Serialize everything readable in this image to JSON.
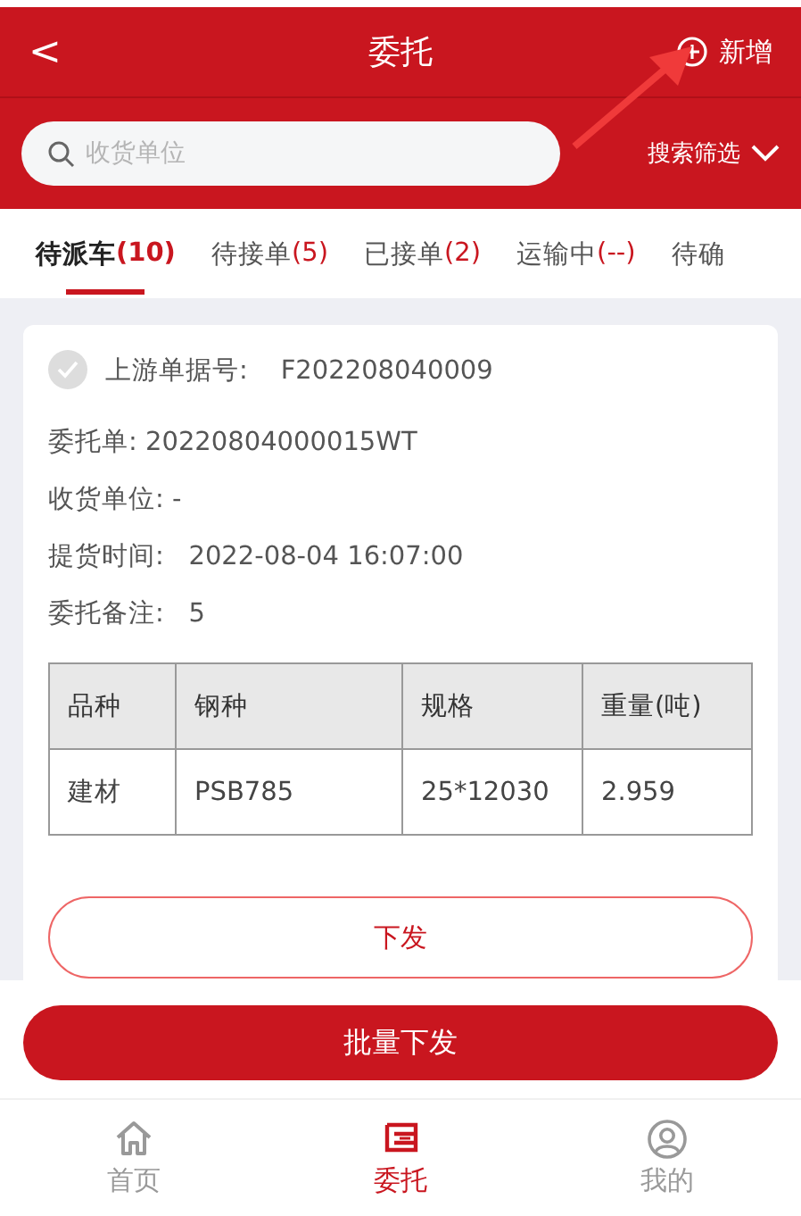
{
  "header": {
    "back": "<",
    "title": "委托",
    "action": "新增"
  },
  "search": {
    "placeholder": "收货单位",
    "filter": "搜索筛选"
  },
  "tabs": [
    {
      "label": "待派车",
      "count": "(10)",
      "selected": true
    },
    {
      "label": "待接单",
      "count": "(5)",
      "selected": false
    },
    {
      "label": "已接单",
      "count": "(2)",
      "selected": false
    },
    {
      "label": "运输中",
      "count": "(--)",
      "selected": false
    },
    {
      "label": "待确",
      "selected": false
    }
  ],
  "card": {
    "checked": false,
    "fields": [
      "上游单据号:    F202208040009",
      "委托单: 20220804000015WT",
      "收货单位: -",
      "提货时间:   2022-08-04 16:07:00",
      "委托备注:   5"
    ],
    "table": {
      "columns": [
        "品种",
        "钢种",
        "规格",
        "重量(吨)"
      ],
      "rows": [
        [
          "建材",
          "PSB785",
          "25*12030",
          "2.959"
        ]
      ]
    },
    "button": "下发"
  },
  "bulk_button": "批量下发",
  "nav": [
    {
      "label": "首页",
      "kind": "home",
      "selected": false
    },
    {
      "label": "委托",
      "kind": "entrust",
      "selected": true
    },
    {
      "label": "我的",
      "kind": "user",
      "selected": false
    }
  ]
}
